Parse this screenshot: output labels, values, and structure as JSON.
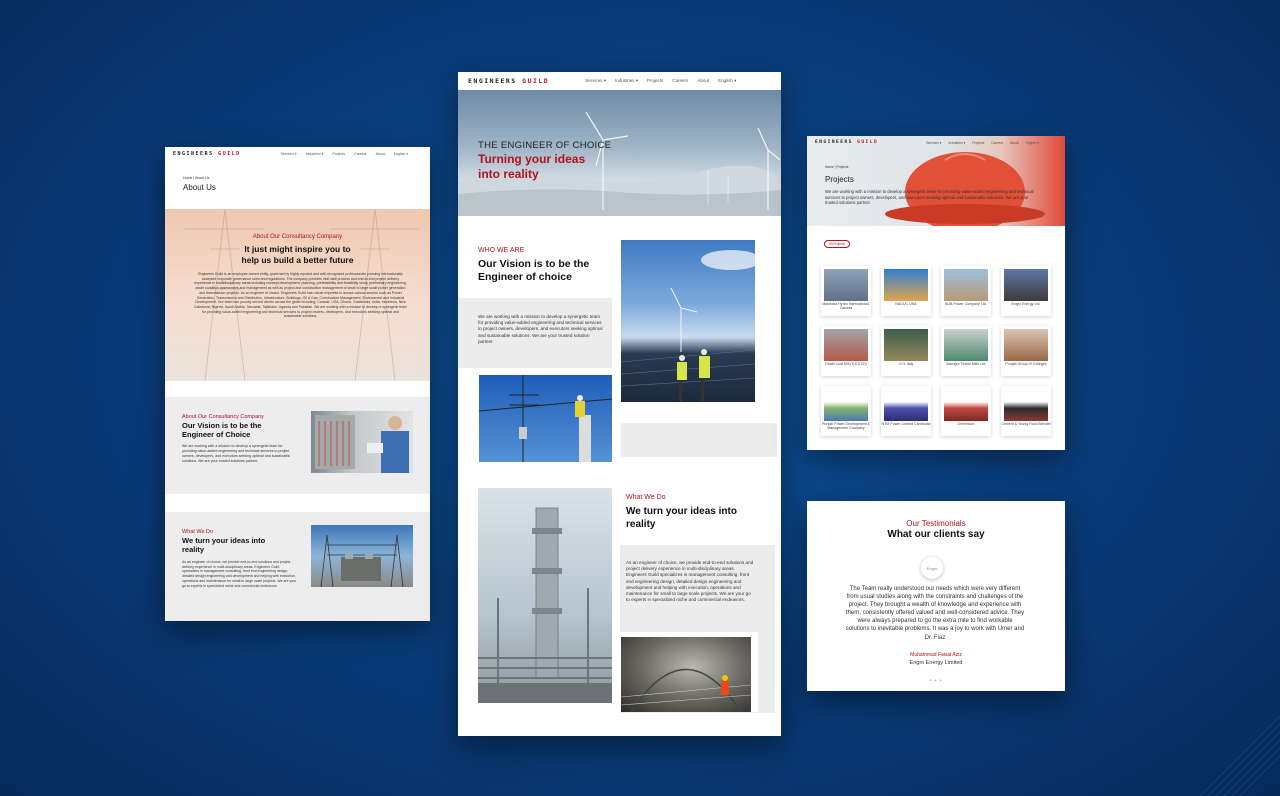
{
  "brand": {
    "logo_main": "ENGINEERS",
    "logo_accent": "GUILD"
  },
  "nav": {
    "items": [
      "Services ▾",
      "Industries ▾",
      "Projects",
      "Careers",
      "About",
      "English ▾"
    ]
  },
  "about_page": {
    "breadcrumb": "Home | About Us",
    "title": "About Us",
    "hero_kicker": "About Our Consultancy Company",
    "hero_heading_1": "It just might inspire you to",
    "hero_heading_2": "help us build a better future",
    "hero_body": "Engineers Guild is an employee owned entity, governed by highly reputed and well-recognized professionals pursuing internationally accepted corporate governance rules and regulations. The company provides vital staff process and end-to-end project delivery experience in multidisciplinary areas including concept development, planning, prefeasibility and feasibility study, preliminary engineering, asset condition assessment and management as well as project and construction management of small to large scale power generation and transmission projects. As an engineer of choice, Engineers Guild has robust expertise in across various sectors such as Power Generation, Transmission and Distribution, Infrastructure, Buildings, Oil & Gas, Construction Management, Environment and Industrial Development. Our team has proudly served clients across the globe including; Canada, USA, Ghana, Guatemala, India, Indonesia, New Caledonia, Nigeria, Saudi Arabia, Tanzania, Tajikistan, Uganda and Pakistan. We are working with a mission to develop a synergetic team for providing value-added engineering and technical services to project owners, developers, and executors seeking optimal and sustainable solutions.",
    "vision_kicker": "About Our Consultancy Company",
    "vision_heading_1": "Our Vision is to be the",
    "vision_heading_2": "Engineer of Choice",
    "vision_body": "We are working with a mission to develop a synergetic team for providing value-added engineering and technical services to project owners, developers, and executors seeking optimal and sustainable solutions. We are your trusted solutions partner.",
    "whatwedo_kicker": "What We Do",
    "whatwedo_heading_1": "We turn your ideas into",
    "whatwedo_heading_2": "reality",
    "whatwedo_body": "As an engineer of choice, we provide end-to-end solutions and project delivery experience in multi-disciplinary areas. Engineers Guild specializes in management consulting, front end engineering design, detailed design engineering and development and helping with execution, operations and maintenance for small to large scale projects. We are your go to experts in specialized niche and commercial endeavors."
  },
  "home_page": {
    "hero_kicker": "THE ENGINEER OF CHOICE",
    "hero_heading_1": "Turning your ideas",
    "hero_heading_2": "into reality",
    "who_kicker": "WHO WE ARE",
    "who_heading_1": "Our Vision is to be the",
    "who_heading_2": "Engineer of choice",
    "who_body": "We are working with a mission to develop a synergetic team for providing value-added engineering and technical services to project owners, developers, and executors seeking optimal and sustainable solutions. We are your trusted solution partner.",
    "what_kicker": "What We Do",
    "what_heading_1": "We turn your ideas into",
    "what_heading_2": "reality",
    "what_body": "As an engineer of choice, we provide end-to-end solutions and project delivery experience in multi-disciplinary areas. Engineers Guild specializes in management consulting, front end engineering design, detailed design engineering and development and helping with execution, operations and maintenance for small to large scale projects. We are your go to experts in specialized niche and commercial endeavors."
  },
  "projects_page": {
    "breadcrumb": "Home | Projects",
    "title": "Projects",
    "body": "We are working with a mission to develop a synergetic team for providing value-added engineering and technical services to project owners, developers, and executors seeking optimal and sustainable solutions. We are your trusted solutions partner.",
    "filter_label": "All Projects",
    "items": [
      "Manitoba Hydro International, Canada",
      "NADUC USA",
      "BUB Power Company Ltd.",
      "Engro Energy Ltd.",
      "Dhabi Coal Mill (K-ES Ch)",
      "CCL Italy",
      "Zahidjee Textile Mills Ltd.",
      "Punjab Group of Colleges",
      "Punjab Power Development & Management Company",
      "NTM Power Limited Cambodia",
      "Dimension",
      "Cement & Young Food Blender"
    ]
  },
  "testimonials": {
    "kicker": "Our Testimonials",
    "heading": "What our clients say",
    "avatar_label": "Engro",
    "quote": "The Team really understood our needs which were very different from usual studies along with the constraints and challenges of the project. They brought a wealth of knowledge and experience with them, consistently offered valued and well-considered advice. They were always prepared to go the extra mile to find workable solutions to inevitable problems. It was a joy to work with Umer and Dr. Fiaz",
    "author": "Muhammad Faisal Aziz",
    "company": "Engro Energy Limited"
  },
  "colors": {
    "accent": "#b3121b",
    "background": "#0a3f7e"
  }
}
